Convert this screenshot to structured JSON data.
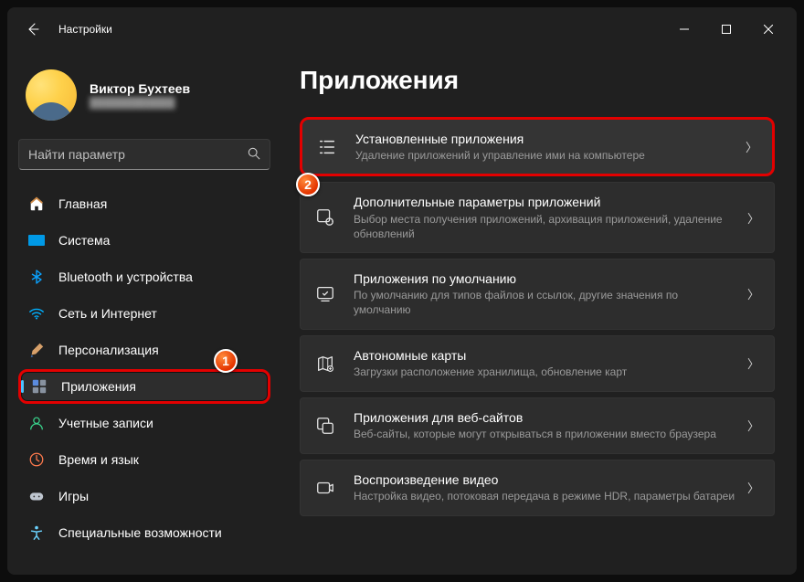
{
  "titlebar": {
    "title": "Настройки"
  },
  "user": {
    "name": "Виктор Бухтеев",
    "email_masked": "████████████"
  },
  "search": {
    "placeholder": "Найти параметр"
  },
  "nav": {
    "items": [
      {
        "label": "Главная"
      },
      {
        "label": "Система"
      },
      {
        "label": "Bluetooth и устройства"
      },
      {
        "label": "Сеть и Интернет"
      },
      {
        "label": "Персонализация"
      },
      {
        "label": "Приложения"
      },
      {
        "label": "Учетные записи"
      },
      {
        "label": "Время и язык"
      },
      {
        "label": "Игры"
      },
      {
        "label": "Специальные возможности"
      }
    ]
  },
  "page": {
    "title": "Приложения"
  },
  "cards": [
    {
      "title": "Установленные приложения",
      "sub": "Удаление приложений и управление ими на компьютере"
    },
    {
      "title": "Дополнительные параметры приложений",
      "sub": "Выбор места получения приложений, архивация приложений, удаление обновлений"
    },
    {
      "title": "Приложения по умолчанию",
      "sub": "По умолчанию для типов файлов и ссылок, другие значения по умолчанию"
    },
    {
      "title": "Автономные карты",
      "sub": "Загрузки расположение хранилища, обновление карт"
    },
    {
      "title": "Приложения для веб-сайтов",
      "sub": "Веб-сайты, которые могут открываться в приложении вместо браузера"
    },
    {
      "title": "Воспроизведение видео",
      "sub": "Настройка видео, потоковая передача в режиме HDR, параметры батареи"
    }
  ],
  "annotations": {
    "badge1": "1",
    "badge2": "2"
  }
}
